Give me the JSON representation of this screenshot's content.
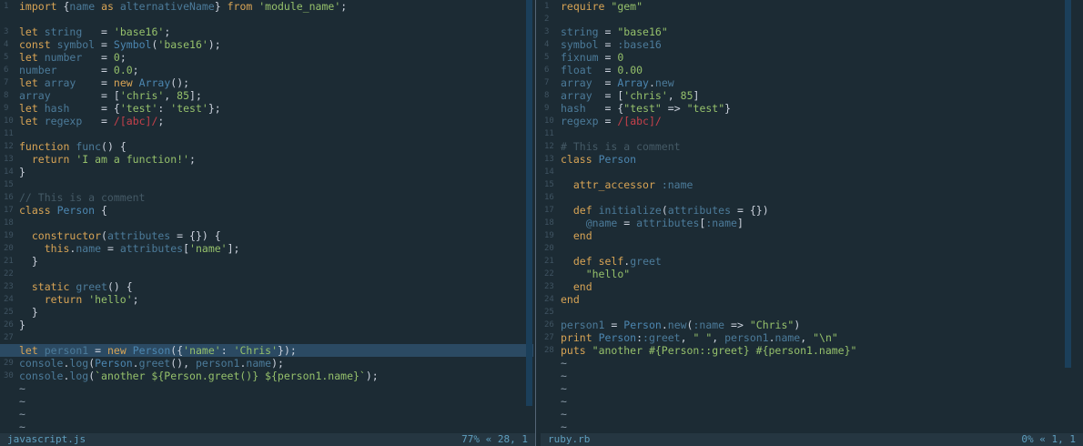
{
  "left": {
    "filename": "javascript.js",
    "position": "77% « 28, 1",
    "lines": [
      "import {name as alternativeName} from 'module_name';",
      "",
      "let string   = 'base16';",
      "const symbol = Symbol('base16');",
      "let number   = 0;",
      "number       = 0.0;",
      "let array    = new Array();",
      "array        = ['chris', 85];",
      "let hash     = {'test': 'test'};",
      "let regexp   = /[abc]/;",
      "",
      "function func() {",
      "  return 'I am a function!';",
      "}",
      "",
      "// This is a comment",
      "class Person {",
      "",
      "  constructor(attributes = {}) {",
      "    this.name = attributes['name'];",
      "  }",
      "",
      "  static greet() {",
      "    return 'hello';",
      "  }",
      "}",
      "",
      "let person1 = new Person({'name': 'Chris'});",
      "console.log(Person.greet(), person1.name);",
      "console.log(`another ${Person.greet()} ${person1.name}`);",
      "~",
      "~",
      "~",
      "~"
    ],
    "numbers": [
      "1",
      "",
      "3",
      "4",
      "5",
      "6",
      "7",
      "8",
      "9",
      "10",
      "11",
      "12",
      "13",
      "14",
      "15",
      "16",
      "17",
      "18",
      "19",
      "20",
      "21",
      "22",
      "23",
      "24",
      "25",
      "26",
      "27",
      "",
      "29",
      "30",
      "",
      "",
      "",
      ""
    ]
  },
  "right": {
    "filename": "ruby.rb",
    "position": "0% « 1, 1",
    "lines": [
      "require \"gem\"",
      "",
      "string = \"base16\"",
      "symbol = :base16",
      "fixnum = 0",
      "float  = 0.00",
      "array  = Array.new",
      "array  = ['chris', 85]",
      "hash   = {\"test\" => \"test\"}",
      "regexp = /[abc]/",
      "",
      "# This is a comment",
      "class Person",
      "",
      "  attr_accessor :name",
      "",
      "  def initialize(attributes = {})",
      "    @name = attributes[:name]",
      "  end",
      "",
      "  def self.greet",
      "    \"hello\"",
      "  end",
      "end",
      "",
      "person1 = Person.new(:name => \"Chris\")",
      "print Person::greet, \" \", person1.name, \"\\n\"",
      "puts \"another #{Person::greet} #{person1.name}\"",
      "~",
      "~",
      "~",
      "~",
      "~",
      "~"
    ],
    "numbers": [
      "1",
      "2",
      "3",
      "4",
      "5",
      "6",
      "7",
      "8",
      "9",
      "10",
      "11",
      "12",
      "13",
      "14",
      "15",
      "16",
      "17",
      "18",
      "19",
      "20",
      "21",
      "22",
      "23",
      "24",
      "25",
      "26",
      "27",
      "28",
      "",
      "",
      "",
      "",
      "",
      ""
    ]
  },
  "colors": {
    "keyword": "#d8a455",
    "string": "#95c06b",
    "number": "#95c06b",
    "identifier": "#4c7b9a",
    "comment": "#455a66",
    "regex": "#c7414b",
    "plain": "#cdd3de",
    "func": "#4c86b0"
  }
}
